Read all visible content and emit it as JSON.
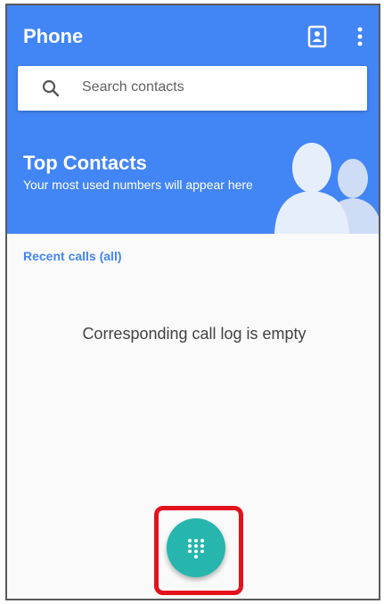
{
  "appbar": {
    "title": "Phone",
    "contacts_icon": "contacts-icon",
    "more_icon": "more-vert-icon"
  },
  "search": {
    "placeholder": "Search contacts",
    "icon": "search-icon"
  },
  "top_contacts": {
    "title": "Top Contacts",
    "subtitle": "Your most used numbers will appear here",
    "illustration": "people-silhouette-icon"
  },
  "recent": {
    "link_label": "Recent calls (all)",
    "empty_message": "Corresponding call log is empty"
  },
  "fab": {
    "icon": "dialpad-icon",
    "color": "#26b6ad"
  },
  "colors": {
    "primary": "#4285f4",
    "highlight": "#e4121d"
  }
}
